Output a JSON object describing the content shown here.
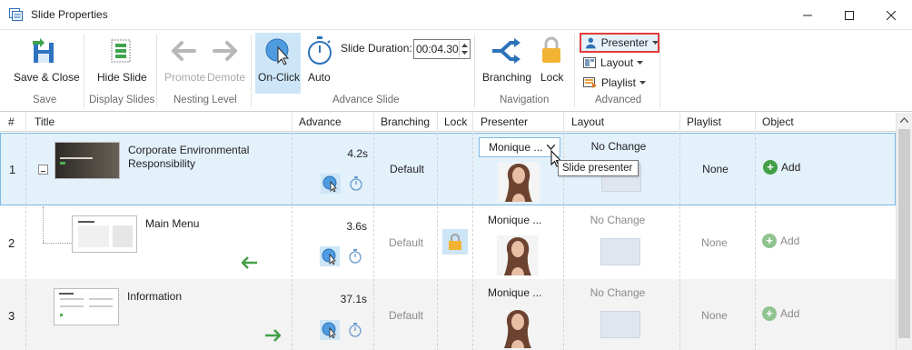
{
  "window": {
    "title": "Slide Properties",
    "minimize_label": "—",
    "maximize_label": "□",
    "close_label": "✕"
  },
  "ribbon": {
    "save_close": "Save & Close",
    "hide_slide": "Hide Slide",
    "promote": "Promote",
    "demote": "Demote",
    "on_click": "On-Click",
    "auto": "Auto",
    "slide_duration_label": "Slide Duration:",
    "slide_duration_value": "00:04.30",
    "branching": "Branching",
    "lock": "Lock",
    "presenter": "Presenter",
    "layout": "Layout",
    "playlist": "Playlist",
    "groups": {
      "save": "Save",
      "display_slides": "Display Slides",
      "nesting_level": "Nesting Level",
      "advance_slide": "Advance Slide",
      "navigation": "Navigation",
      "advanced": "Advanced"
    }
  },
  "grid": {
    "columns": [
      "#",
      "Title",
      "Advance",
      "Branching",
      "Lock",
      "Presenter",
      "Layout",
      "Playlist",
      "Object"
    ],
    "rows": [
      {
        "num": "1",
        "title": "Corporate Environmental Responsibility",
        "advance": "4.2s",
        "branching": "Default",
        "presenter": "Monique ...",
        "layout": "No Change",
        "playlist": "None",
        "object": "Add"
      },
      {
        "num": "2",
        "title": "Main Menu",
        "advance": "3.6s",
        "branching": "Default",
        "presenter": "Monique ...",
        "layout": "No Change",
        "playlist": "None",
        "object": "Add"
      },
      {
        "num": "3",
        "title": "Information",
        "advance": "37.1s",
        "branching": "Default",
        "presenter": "Monique ...",
        "layout": "No Change",
        "playlist": "None",
        "object": "Add"
      }
    ]
  },
  "tooltip": "Slide presenter",
  "thumb_text": {
    "slide1": "Corporate Environmental Responsibility",
    "slide2": "Main Menu",
    "slide3": "Information"
  },
  "colors": {
    "selected_row": "#e3f1fb",
    "accent": "#2e8ed8",
    "highlight_border": "#e33b3b",
    "add_green": "#43a047"
  }
}
